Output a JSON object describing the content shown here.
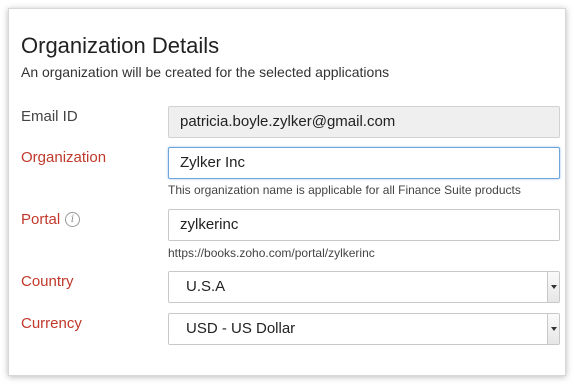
{
  "header": {
    "title": "Organization Details",
    "subtitle": "An organization will be created for the selected applications"
  },
  "form": {
    "email": {
      "label": "Email ID",
      "value": "patricia.boyle.zylker@gmail.com"
    },
    "organization": {
      "label": "Organization",
      "value": "Zylker Inc",
      "hint": "This organization name is applicable for all Finance Suite products"
    },
    "portal": {
      "label": "Portal",
      "info_icon": "info-icon",
      "info_glyph": "i",
      "value": "zylkerinc",
      "hint": "https://books.zoho.com/portal/zylkerinc"
    },
    "country": {
      "label": "Country",
      "selected": "U.S.A"
    },
    "currency": {
      "label": "Currency",
      "selected": "USD - US Dollar"
    }
  },
  "colors": {
    "required_label": "#c0392b",
    "focus_border": "#6ea6dc",
    "readonly_bg": "#efefef"
  }
}
